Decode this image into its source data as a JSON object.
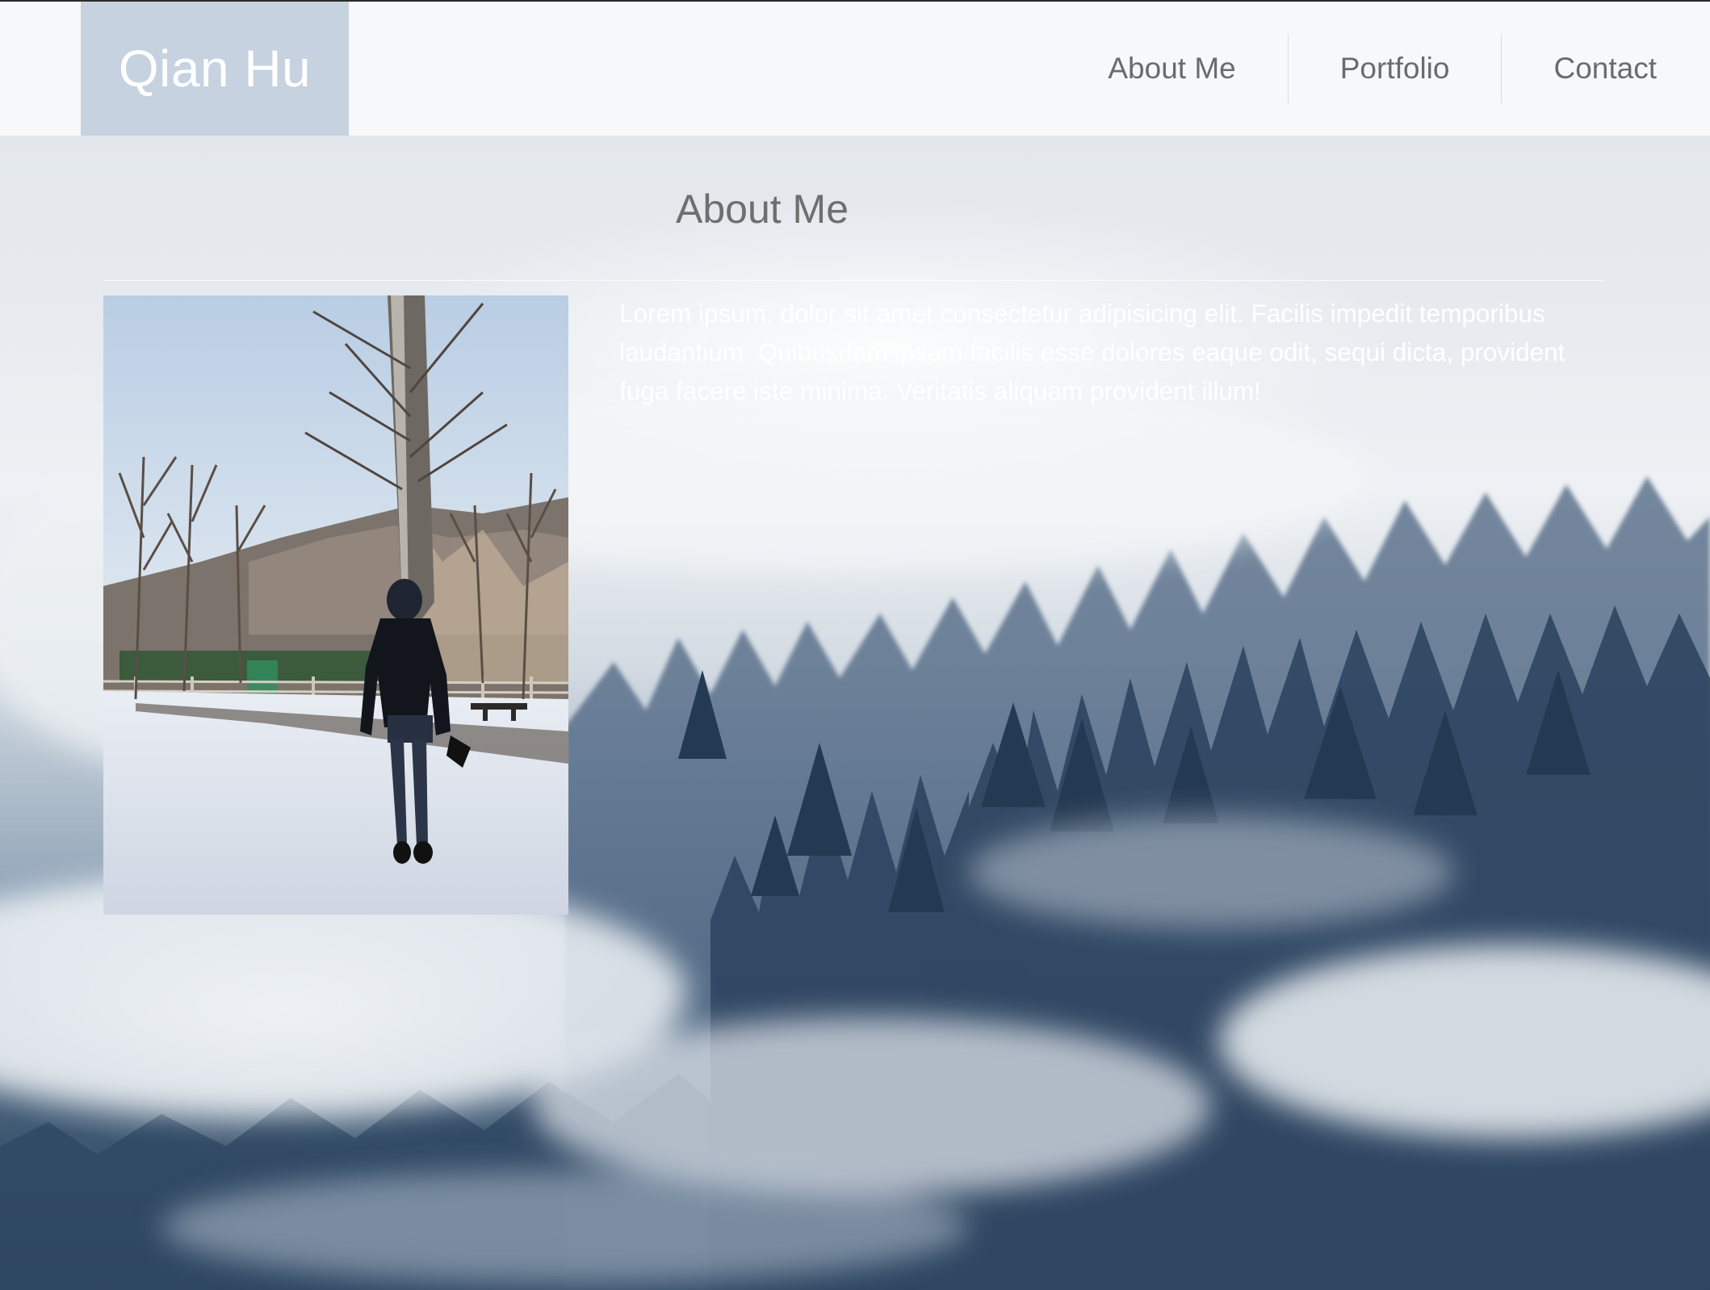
{
  "navbar": {
    "brand": "Qian Hu",
    "items": [
      {
        "label": "About Me"
      },
      {
        "label": "Portfolio"
      },
      {
        "label": "Contact"
      }
    ]
  },
  "about": {
    "title": "About Me",
    "bio": "Lorem ipsum, dolor sit amet consectetur adipisicing elit. Facilis impedit temporibus laudantium. Quibusdam ipsam facilis esse dolores eaque odit, sequi dicta, provident fuga facere iste minima. Veritatis aliquam provident illum!"
  },
  "colors": {
    "brand_bg": "#c6d2e0",
    "navbar_bg": "#f7f8fa",
    "nav_text": "#6b6b6b",
    "bio_text": "#ffffff"
  }
}
